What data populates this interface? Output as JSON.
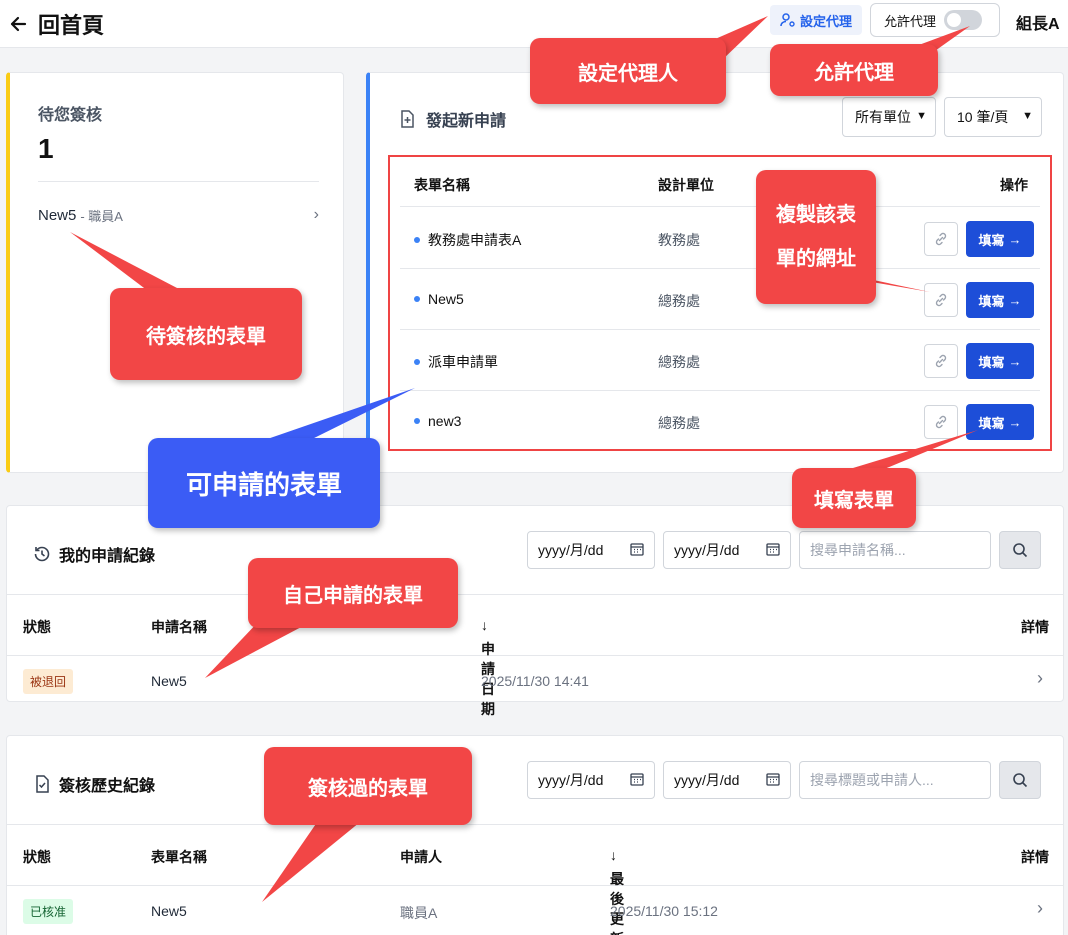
{
  "header": {
    "back_label": "回首頁",
    "proxy_button": "設定代理",
    "allow_proxy_label": "允許代理",
    "user_name": "組長A"
  },
  "pending": {
    "label": "待您簽核",
    "count": "1",
    "items": [
      {
        "name": "New5",
        "role": "- 職員A"
      }
    ]
  },
  "new_application": {
    "title": "發起新申請",
    "unit_select": "所有單位",
    "page_size_select": "10 筆/頁",
    "columns": {
      "name": "表單名稱",
      "unit": "設計單位",
      "action": "操作"
    },
    "fill_label": "填寫",
    "rows": [
      {
        "name": "教務處申請表A",
        "unit": "教務處"
      },
      {
        "name": "New5",
        "unit": "總務處"
      },
      {
        "name": "派車申請單",
        "unit": "總務處"
      },
      {
        "name": "new3",
        "unit": "總務處"
      }
    ]
  },
  "my_records": {
    "title": "我的申請紀錄",
    "date_placeholder": "yyyy/月/dd",
    "search_placeholder": "搜尋申請名稱...",
    "columns": {
      "status": "狀態",
      "name": "申請名稱",
      "date": "申請日期",
      "detail": "詳情"
    },
    "rows": [
      {
        "status": "被退回",
        "name": "New5",
        "date": "2025/11/30 14:41"
      }
    ]
  },
  "review_history": {
    "title": "簽核歷史紀錄",
    "date_placeholder": "yyyy/月/dd",
    "search_placeholder": "搜尋標題或申請人...",
    "columns": {
      "status": "狀態",
      "name": "表單名稱",
      "applicant": "申請人",
      "updated": "最後更新",
      "detail": "詳情"
    },
    "rows": [
      {
        "status": "已核准",
        "name": "New5",
        "applicant": "職員A",
        "updated": "2025/11/30 15:12"
      }
    ]
  },
  "callouts": {
    "set_proxy": "設定代理人",
    "allow_proxy": "允許代理",
    "pending_forms": "待簽核的表單",
    "copy_link_line1": "複製該表",
    "copy_link_line2": "單的網址",
    "available_forms": "可申請的表單",
    "fill_form": "填寫表單",
    "my_forms": "自己申請的表單",
    "reviewed_forms": "簽核過的表單"
  },
  "colors": {
    "callout_red": "#f24646",
    "callout_blue": "#3b5cf5",
    "primary": "#1d4ed8",
    "pending_accent": "#facc15",
    "new_accent": "#3b82f6",
    "rejected_bg": "#fdebd3",
    "approved_bg": "#dcfce7"
  }
}
